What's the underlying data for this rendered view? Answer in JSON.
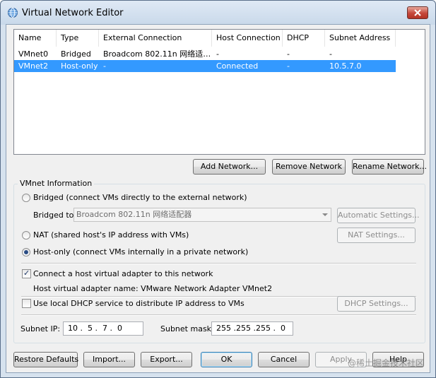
{
  "window": {
    "title": "Virtual Network Editor"
  },
  "list": {
    "columns": [
      "Name",
      "Type",
      "External Connection",
      "Host Connection",
      "DHCP",
      "Subnet Address"
    ],
    "rows": [
      {
        "name": "VMnet0",
        "type": "Bridged",
        "external": "Broadcom 802.11n 网络适…",
        "host": "-",
        "dhcp": "-",
        "subnet": "-",
        "selected": false
      },
      {
        "name": "VMnet2",
        "type": "Host-only",
        "external": "-",
        "host": "Connected",
        "dhcp": "-",
        "subnet": "10.5.7.0",
        "selected": true
      }
    ]
  },
  "list_buttons": {
    "add": "Add Network...",
    "remove": "Remove Network",
    "rename": "Rename Network..."
  },
  "vmnet_info": {
    "group_label": "VMnet Information",
    "bridged_label": "Bridged (connect VMs directly to the external network)",
    "bridged_to_label": "Bridged to:",
    "bridged_to_value": "Broadcom 802.11n 网络适配器",
    "automatic_settings": "Automatic Settings...",
    "nat_label": "NAT (shared host's IP address with VMs)",
    "nat_settings": "NAT Settings...",
    "hostonly_label": "Host-only (connect VMs internally in a private network)",
    "connect_adapter_label": "Connect a host virtual adapter to this network",
    "adapter_name_label": "Host virtual adapter name: VMware Network Adapter VMnet2",
    "dhcp_label": "Use local DHCP service to distribute IP address to VMs",
    "dhcp_settings": "DHCP Settings...",
    "subnet_ip_label": "Subnet IP:",
    "subnet_ip_value": "10 .  5 .  7 .  0",
    "subnet_mask_label": "Subnet mask:",
    "subnet_mask_value": "255 .255 .255 .  0",
    "selected_mode": "host-only",
    "connect_adapter_checked": true,
    "dhcp_checked": false
  },
  "bottom_buttons": {
    "restore": "Restore Defaults",
    "import": "Import...",
    "export": "Export...",
    "ok": "OK",
    "cancel": "Cancel",
    "apply": "Apply",
    "help": "Help"
  },
  "watermark": "@稀土掘金技术社区",
  "colors": {
    "selection": "#3399ff",
    "titlebar": "#c9d9ea",
    "close": "#c5473a"
  }
}
